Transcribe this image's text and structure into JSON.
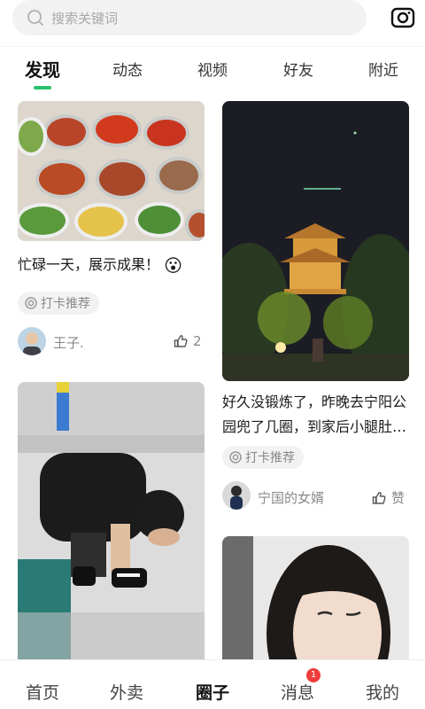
{
  "search": {
    "placeholder": "搜索关键词"
  },
  "tabs": [
    {
      "label": "发现",
      "active": true
    },
    {
      "label": "动态"
    },
    {
      "label": "视频"
    },
    {
      "label": "好友"
    },
    {
      "label": "附近"
    }
  ],
  "feed": [
    {
      "caption": "忙碌一天，展示成果！",
      "emoji": "😮",
      "tag": "打卡推荐",
      "user": "王子.",
      "likes": "2",
      "photo": "food-dishes"
    },
    {
      "caption": "好久没锻炼了，昨晚去宁阳公园兜了几圈，到家后小腿肚…",
      "tag": "打卡推荐",
      "user": "宁国的女婿",
      "likes": "赞",
      "photo": "night-pavilion"
    },
    {
      "photo": "child-shoes"
    },
    {
      "photo": "selfie"
    }
  ],
  "bottom_nav": [
    {
      "label": "首页"
    },
    {
      "label": "外卖"
    },
    {
      "label": "圈子",
      "active": true
    },
    {
      "label": "消息",
      "badge": "1"
    },
    {
      "label": "我的"
    }
  ],
  "colors": {
    "accent": "#27c26c",
    "badge": "#f03c3c"
  }
}
